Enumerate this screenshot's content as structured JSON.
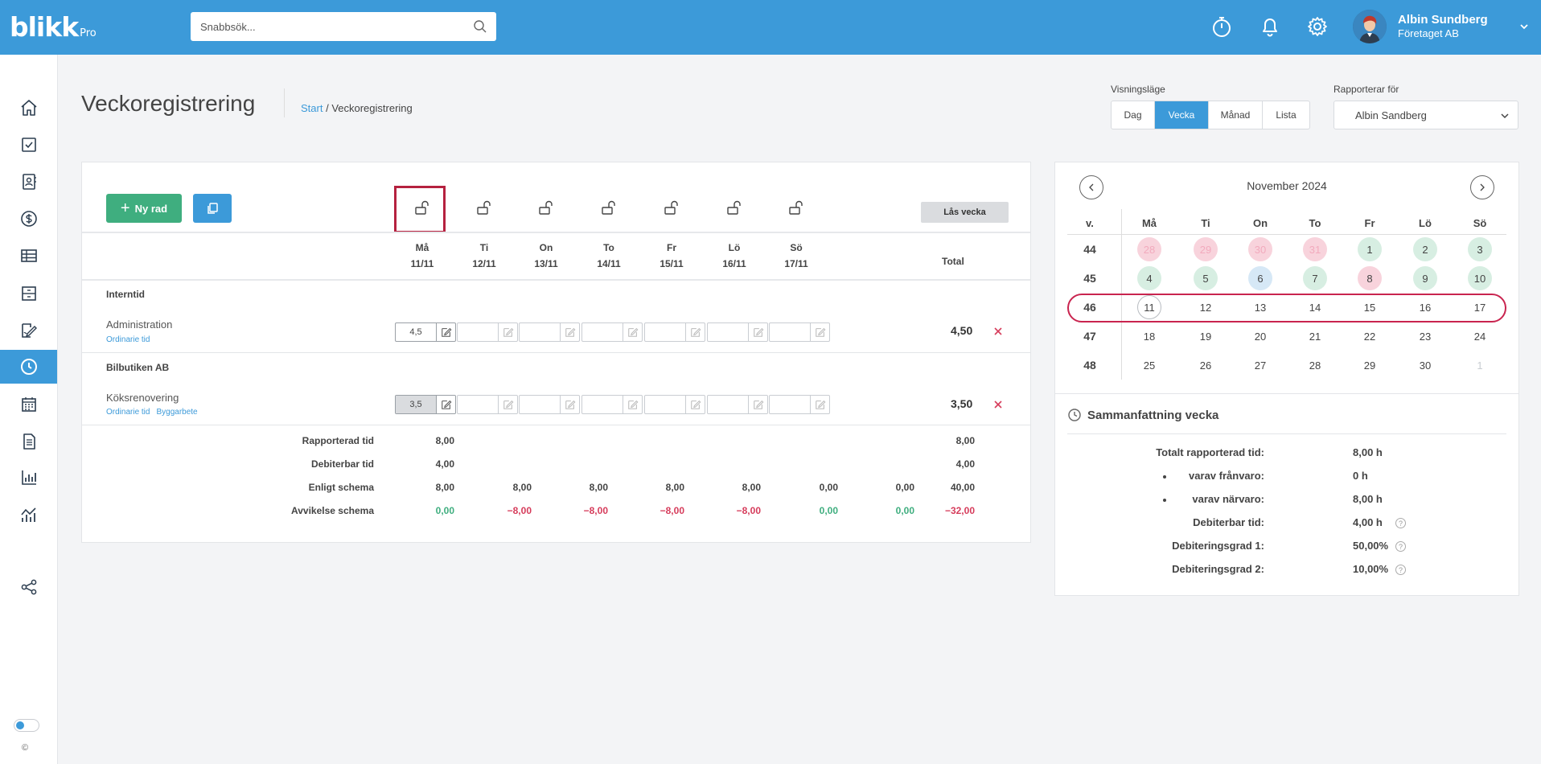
{
  "header": {
    "logo": "blikk",
    "logo_suffix": "Pro",
    "search_placeholder": "Snabbsök...",
    "icons": [
      "stopwatch-icon",
      "bell-icon",
      "gear-icon",
      "search-icon"
    ],
    "user": {
      "name": "Albin Sundberg",
      "company": "Företaget AB"
    }
  },
  "sidebar": {
    "items": [
      "home-icon",
      "checkbox-icon",
      "contacts-icon",
      "dollar-icon",
      "table-icon",
      "archive-icon",
      "signature-icon",
      "clock-icon",
      "calendar-icon",
      "document-icon",
      "bar-chart-icon",
      "line-chart-icon",
      "share-icon"
    ],
    "active": "clock-icon",
    "copyright": "©"
  },
  "page": {
    "title": "Veckoregistrering",
    "breadcrumb_link": "Start",
    "breadcrumb_sep": " / ",
    "breadcrumb_current": "Veckoregistrering"
  },
  "view_mode": {
    "label": "Visningsläge",
    "options": [
      "Dag",
      "Vecka",
      "Månad",
      "Lista"
    ],
    "selected": "Vecka"
  },
  "report_for": {
    "label": "Rapporterar för",
    "value": "Albin Sandberg"
  },
  "week": {
    "new_row_label": "Ny rad",
    "lock_week_label": "Lås vecka",
    "total_label": "Total",
    "days": [
      {
        "name": "Må",
        "date": "11/11"
      },
      {
        "name": "Ti",
        "date": "12/11"
      },
      {
        "name": "On",
        "date": "13/11"
      },
      {
        "name": "To",
        "date": "14/11"
      },
      {
        "name": "Fr",
        "date": "15/11"
      },
      {
        "name": "Lö",
        "date": "16/11"
      },
      {
        "name": "Sö",
        "date": "17/11"
      }
    ],
    "groups": [
      {
        "name": "Interntid",
        "rows": [
          {
            "title": "Administration",
            "tags": [
              "Ordinarie tid"
            ],
            "values": [
              "4,5",
              "",
              "",
              "",
              "",
              "",
              ""
            ],
            "total": "4,50"
          }
        ]
      },
      {
        "name": "Bilbutiken AB",
        "rows": [
          {
            "title": "Köksrenovering",
            "tags": [
              "Ordinarie tid",
              "Byggarbete"
            ],
            "values": [
              "3,5",
              "",
              "",
              "",
              "",
              "",
              ""
            ],
            "total": "3,50"
          }
        ]
      }
    ],
    "summary": [
      {
        "label": "Rapporterad tid",
        "values": [
          "8,00",
          "",
          "",
          "",
          "",
          "",
          ""
        ],
        "total": "8,00"
      },
      {
        "label": "Debiterbar tid",
        "values": [
          "4,00",
          "",
          "",
          "",
          "",
          "",
          ""
        ],
        "total": "4,00"
      },
      {
        "label": "Enligt schema",
        "values": [
          "8,00",
          "8,00",
          "8,00",
          "8,00",
          "8,00",
          "0,00",
          "0,00"
        ],
        "total": "40,00"
      },
      {
        "label": "Avvikelse schema",
        "values": [
          "0,00",
          "−8,00",
          "−8,00",
          "−8,00",
          "−8,00",
          "0,00",
          "0,00"
        ],
        "total": "−32,00"
      }
    ],
    "colors": {
      "positive": "#3fae7f",
      "negative": "#d63c5b",
      "accent": "#3c9ad9",
      "highlight": "#b5213f"
    }
  },
  "calendar": {
    "month": "November 2024",
    "week_header": "v.",
    "day_headers": [
      "Må",
      "Ti",
      "On",
      "To",
      "Fr",
      "Lö",
      "Sö"
    ],
    "weeks": [
      {
        "no": "44",
        "days": [
          {
            "d": "28",
            "s": "pink-faded"
          },
          {
            "d": "29",
            "s": "pink-faded"
          },
          {
            "d": "30",
            "s": "pink-faded"
          },
          {
            "d": "31",
            "s": "pink-faded"
          },
          {
            "d": "1",
            "s": "green"
          },
          {
            "d": "2",
            "s": "green"
          },
          {
            "d": "3",
            "s": "green"
          }
        ]
      },
      {
        "no": "45",
        "days": [
          {
            "d": "4",
            "s": "green"
          },
          {
            "d": "5",
            "s": "green"
          },
          {
            "d": "6",
            "s": "blue"
          },
          {
            "d": "7",
            "s": "green"
          },
          {
            "d": "8",
            "s": "pink"
          },
          {
            "d": "9",
            "s": "green"
          },
          {
            "d": "10",
            "s": "green"
          }
        ]
      },
      {
        "no": "46",
        "days": [
          {
            "d": "11",
            "s": "today"
          },
          {
            "d": "12",
            "s": ""
          },
          {
            "d": "13",
            "s": ""
          },
          {
            "d": "14",
            "s": ""
          },
          {
            "d": "15",
            "s": ""
          },
          {
            "d": "16",
            "s": ""
          },
          {
            "d": "17",
            "s": ""
          }
        ]
      },
      {
        "no": "47",
        "days": [
          {
            "d": "18",
            "s": ""
          },
          {
            "d": "19",
            "s": ""
          },
          {
            "d": "20",
            "s": ""
          },
          {
            "d": "21",
            "s": ""
          },
          {
            "d": "22",
            "s": ""
          },
          {
            "d": "23",
            "s": ""
          },
          {
            "d": "24",
            "s": ""
          }
        ]
      },
      {
        "no": "48",
        "days": [
          {
            "d": "25",
            "s": ""
          },
          {
            "d": "26",
            "s": ""
          },
          {
            "d": "27",
            "s": ""
          },
          {
            "d": "28",
            "s": ""
          },
          {
            "d": "29",
            "s": ""
          },
          {
            "d": "30",
            "s": ""
          },
          {
            "d": "1",
            "s": "muted"
          }
        ]
      }
    ],
    "selected_week": "46"
  },
  "week_summary": {
    "title": "Sammanfattning vecka",
    "rows": [
      {
        "label": "Totalt rapporterad tid:",
        "value": "8,00 h",
        "bullet": false,
        "help": false
      },
      {
        "label": "varav frånvaro:",
        "value": "0 h",
        "bullet": true,
        "help": false
      },
      {
        "label": "varav närvaro:",
        "value": "8,00 h",
        "bullet": true,
        "help": false
      },
      {
        "label": "Debiterbar tid:",
        "value": "4,00 h",
        "bullet": false,
        "help": true
      },
      {
        "label": "Debiteringsgrad 1:",
        "value": "50,00%",
        "bullet": false,
        "help": true
      },
      {
        "label": "Debiteringsgrad 2:",
        "value": "10,00%",
        "bullet": false,
        "help": true
      }
    ],
    "help_glyph": "?"
  }
}
